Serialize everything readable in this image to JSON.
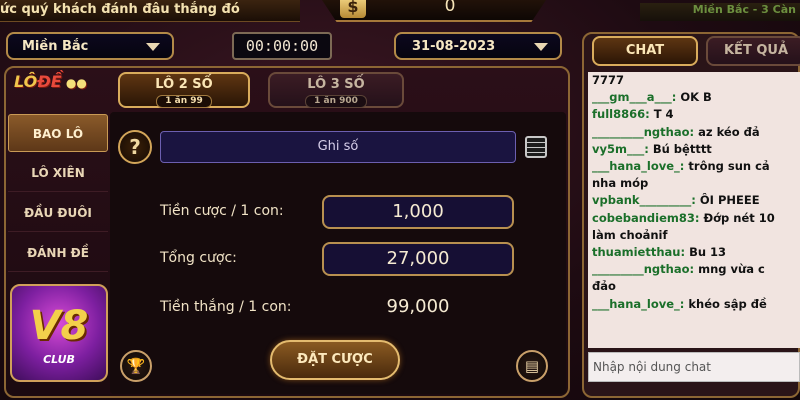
{
  "top": {
    "marquee": "ức quý khách đánh đâu thắng đó",
    "balance_symbol": "$",
    "balance": "0",
    "region_banner": "Miền Bắc - 3 Càn"
  },
  "selectors": {
    "region": "Miền Bắc",
    "timer": "00:00:00",
    "date": "31-08-2023"
  },
  "sidebar": {
    "logo_text_1": "LÔ",
    "logo_text_2": "ĐỀ",
    "items": [
      "BAO LÔ",
      "LÔ XIÊN",
      "ĐẦU ĐUÔI",
      "ĐÁNH ĐỀ"
    ],
    "active_index": 0,
    "brand": "V8",
    "brand_sub": "CLUB"
  },
  "tabs": [
    {
      "label": "LÔ 2 SỐ",
      "rate": "1 ăn 99"
    },
    {
      "label": "LÔ 3 SỐ",
      "rate": "1 ăn 900"
    }
  ],
  "form": {
    "help": "?",
    "numbers_placeholder": "Ghi số",
    "bet_per_label": "Tiền cược / 1 con:",
    "bet_per_value": "1,000",
    "total_label": "Tổng cược:",
    "total_value": "27,000",
    "win_label": "Tiền thắng / 1 con:",
    "win_value": "99,000",
    "submit": "ĐẶT CƯỢC"
  },
  "icons": {
    "help": "question-icon",
    "notepad": "notepad-icon",
    "trophy": "trophy-icon",
    "history": "history-icon"
  },
  "chat": {
    "tab_chat": "CHAT",
    "tab_results": "KẾT QUẢ",
    "messages": [
      {
        "user": "",
        "text": "7777"
      },
      {
        "user": "___gm___a___:",
        "text": " OK B"
      },
      {
        "user": "full8866:",
        "text": " T 4"
      },
      {
        "user": "_________ngthao:",
        "text": " az kéo đả"
      },
      {
        "user": "vy5m___:",
        "text": " Bú bệtttt"
      },
      {
        "user": "___hana_love_:",
        "text": " trông sun cả"
      },
      {
        "user": "",
        "text": "nha móp"
      },
      {
        "user": "vpbank_________:",
        "text": " ÔI PHEEE"
      },
      {
        "user": "cobebandiem83:",
        "text": " Đớp nét 10"
      },
      {
        "user": "",
        "text": "làm choảnif"
      },
      {
        "user": "thuamietthau:",
        "text": " Bu 13"
      },
      {
        "user": "_________ngthao:",
        "text": " mng vừa c"
      },
      {
        "user": "",
        "text": "đảo"
      },
      {
        "user": "___hana_love_:",
        "text": " khéo sập đề"
      }
    ],
    "input_placeholder": "Nhập nội dung chat"
  }
}
